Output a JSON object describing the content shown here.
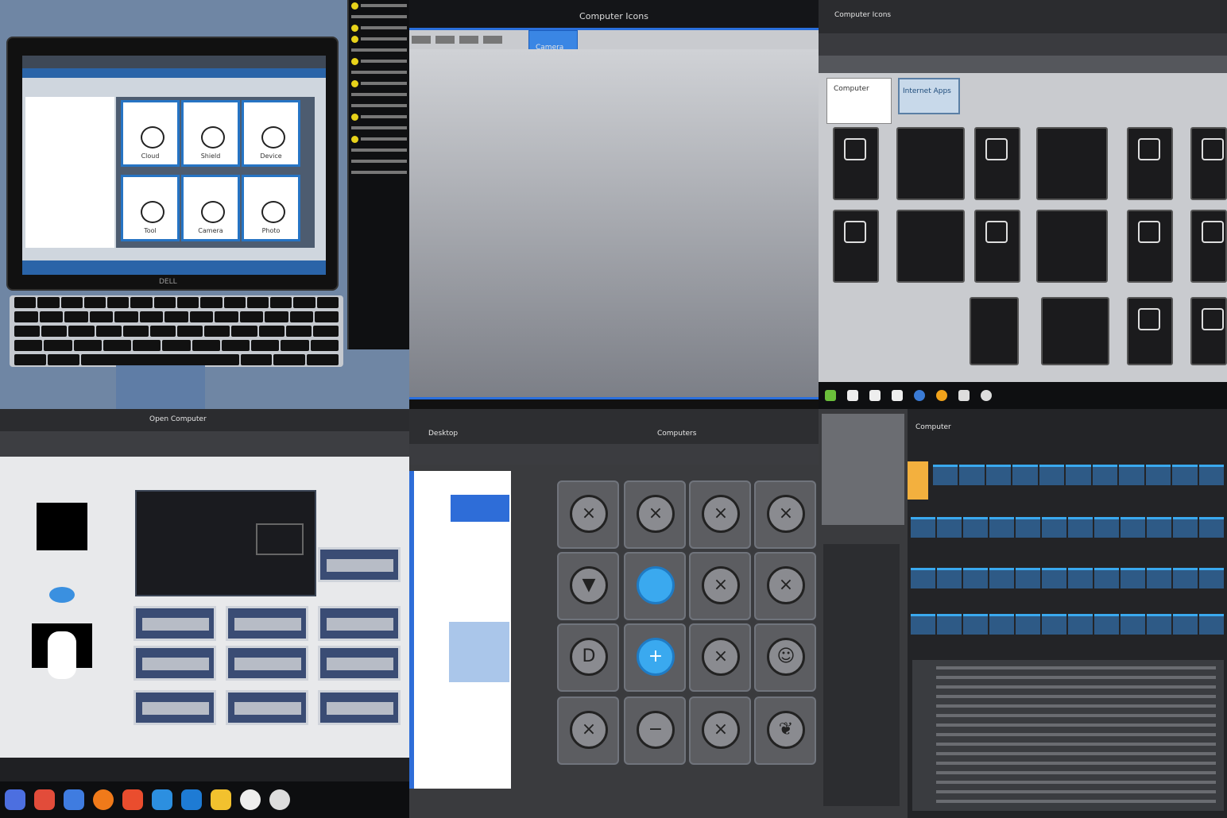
{
  "tiles": {
    "t1": {
      "brand": "DELL",
      "cards": [
        "Cloud",
        "Shield",
        "Device",
        "Tool",
        "Camera",
        "Photo"
      ]
    },
    "t2": {
      "title": "Computer Icons",
      "selected": "Camera"
    },
    "t3": {
      "header": "Computer Icons",
      "paper_label": "Computer",
      "blue_label": "Internet Apps"
    },
    "t4": {
      "title": "Open Computer"
    },
    "t5": {
      "title": "Computers",
      "crumb": "Desktop"
    },
    "t6": {
      "title": "Computer",
      "ribbon_items": 22
    }
  },
  "colors": {
    "accent_blue": "#2a6fdc",
    "cyan": "#3aa9ef",
    "yellow": "#e7d21a"
  }
}
